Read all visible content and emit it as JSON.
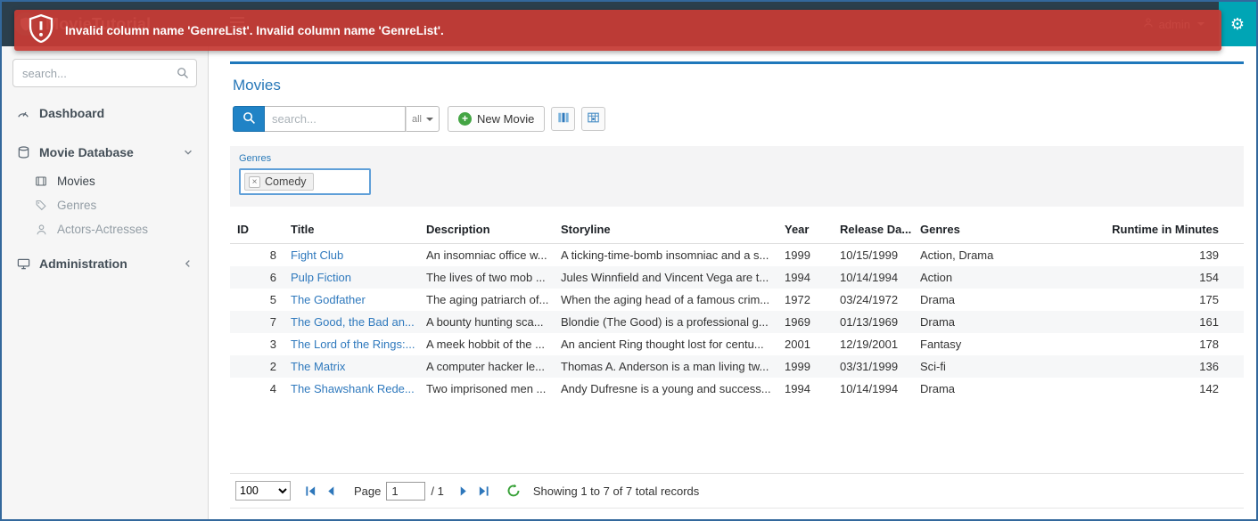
{
  "navbar": {
    "brand": "MovieTutorial",
    "user": "admin"
  },
  "alert": {
    "message": "Invalid column name 'GenreList'. Invalid column name 'GenreList'."
  },
  "icons": {
    "settings": "⚙",
    "plus": "+",
    "remove_tag": "×"
  },
  "colors": {
    "accent_blue": "#2083c6",
    "alert_red": "#c63c35",
    "teal": "#00a5b5",
    "link": "#2f79bd"
  },
  "sidebar": {
    "search_placeholder": "search...",
    "items": [
      {
        "label": "Dashboard"
      },
      {
        "label": "Movie Database",
        "expanded": true,
        "children": [
          {
            "label": "Movies"
          },
          {
            "label": "Genres"
          },
          {
            "label": "Actors-Actresses"
          }
        ]
      },
      {
        "label": "Administration",
        "expanded": false
      }
    ]
  },
  "main": {
    "title": "Movies",
    "toolbar": {
      "search_placeholder": "search...",
      "search_scope": "all",
      "new_movie_label": "New Movie"
    },
    "filter": {
      "label": "Genres",
      "tag": "Comedy"
    },
    "table": {
      "columns": [
        "ID",
        "Title",
        "Description",
        "Storyline",
        "Year",
        "Release Da...",
        "Genres",
        "Runtime in Minutes"
      ],
      "rows": [
        {
          "id": 8,
          "title": "Fight Club",
          "description": "An insomniac office w...",
          "storyline": "A ticking-time-bomb insomniac and a s...",
          "year": 1999,
          "release_date": "10/15/1999",
          "genres": "Action, Drama",
          "runtime": 139
        },
        {
          "id": 6,
          "title": "Pulp Fiction",
          "description": "The lives of two mob ...",
          "storyline": "Jules Winnfield and Vincent Vega are t...",
          "year": 1994,
          "release_date": "10/14/1994",
          "genres": "Action",
          "runtime": 154
        },
        {
          "id": 5,
          "title": "The Godfather",
          "description": "The aging patriarch of...",
          "storyline": "When the aging head of a famous crim...",
          "year": 1972,
          "release_date": "03/24/1972",
          "genres": "Drama",
          "runtime": 175
        },
        {
          "id": 7,
          "title": "The Good, the Bad an...",
          "description": "A bounty hunting sca...",
          "storyline": "Blondie (The Good) is a professional g...",
          "year": 1969,
          "release_date": "01/13/1969",
          "genres": "Drama",
          "runtime": 161
        },
        {
          "id": 3,
          "title": "The Lord of the Rings:...",
          "description": "A meek hobbit of the ...",
          "storyline": "An ancient Ring thought lost for centu...",
          "year": 2001,
          "release_date": "12/19/2001",
          "genres": "Fantasy",
          "runtime": 178
        },
        {
          "id": 2,
          "title": "The Matrix",
          "description": "A computer hacker le...",
          "storyline": "Thomas A. Anderson is a man living tw...",
          "year": 1999,
          "release_date": "03/31/1999",
          "genres": "Sci-fi",
          "runtime": 136
        },
        {
          "id": 4,
          "title": "The Shawshank Rede...",
          "description": "Two imprisoned men ...",
          "storyline": "Andy Dufresne is a young and success...",
          "year": 1994,
          "release_date": "10/14/1994",
          "genres": "Drama",
          "runtime": 142
        }
      ]
    },
    "pagination": {
      "page_size": "100",
      "page_label": "Page",
      "page": "1",
      "total": "/ 1",
      "summary": "Showing 1 to 7 of 7 total records"
    }
  }
}
